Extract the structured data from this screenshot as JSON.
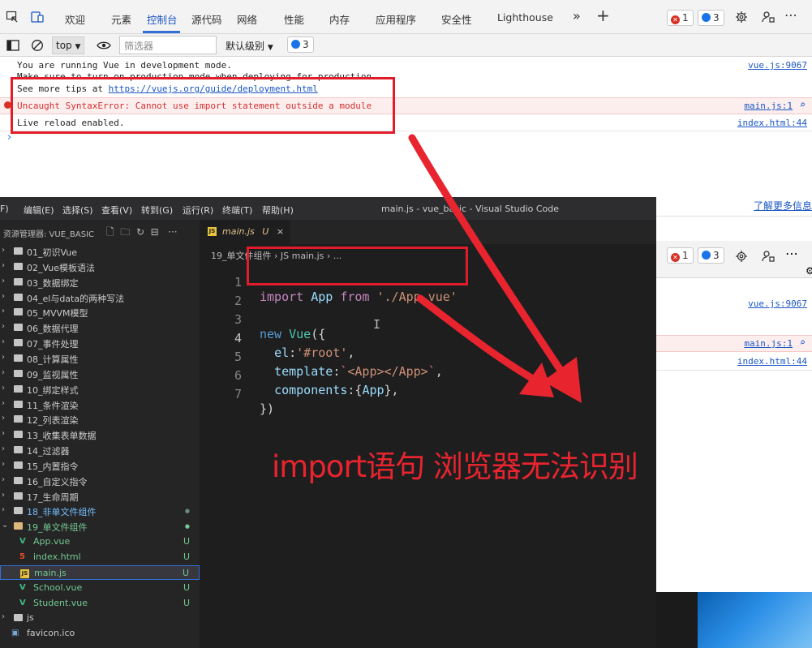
{
  "devtools": {
    "tabs": [
      "欢迎",
      "元素",
      "控制台",
      "源代码",
      "网络",
      "性能",
      "内存",
      "应用程序",
      "安全性",
      "Lighthouse"
    ],
    "active_tab": "控制台",
    "more_tabs": "»",
    "add_tab": "+",
    "error_count": "1",
    "message_count": "3",
    "toolbar": {
      "context": "top",
      "filter_placeholder": "筛选器",
      "level": "默认级别",
      "message_count": "3"
    },
    "console": [
      {
        "text": "You are running Vue in development mode.",
        "source": "vue.js:9067",
        "type": "log"
      },
      {
        "text": "Make sure to turn on production mode when deploying for production.",
        "source": "",
        "type": "log"
      },
      {
        "text": "See more tips at https://vuejs.org/guide/deployment.html",
        "source": "",
        "type": "log"
      },
      {
        "text": "Uncaught SyntaxError: Cannot use import statement outside a module",
        "source": "main.js:1",
        "type": "error"
      },
      {
        "text": "Live reload enabled.",
        "source": "index.html:44",
        "type": "log"
      }
    ],
    "prompt": "›",
    "learn_more": "了解更多信息",
    "second_view": {
      "error_count": "1",
      "message_count": "3",
      "sources": [
        "vue.js:9067",
        "main.js:1",
        "index.html:44"
      ]
    }
  },
  "vscode": {
    "menu": [
      "F)",
      "编辑(E)",
      "选择(S)",
      "查看(V)",
      "转到(G)",
      "运行(R)",
      "终端(T)",
      "帮助(H)"
    ],
    "window_title": "main.js - vue_basic - Visual Studio Code",
    "explorer_title": "资源管理器: VUE_BASIC",
    "tree": [
      {
        "name": "01_初识Vue",
        "kind": "folder"
      },
      {
        "name": "02_Vue模板语法",
        "kind": "folder"
      },
      {
        "name": "03_数据绑定",
        "kind": "folder"
      },
      {
        "name": "04_el与data的两种写法",
        "kind": "folder"
      },
      {
        "name": "05_MVVM模型",
        "kind": "folder"
      },
      {
        "name": "06_数据代理",
        "kind": "folder"
      },
      {
        "name": "07_事件处理",
        "kind": "folder"
      },
      {
        "name": "08_计算属性",
        "kind": "folder"
      },
      {
        "name": "09_监视属性",
        "kind": "folder"
      },
      {
        "name": "10_绑定样式",
        "kind": "folder"
      },
      {
        "name": "11_条件渲染",
        "kind": "folder"
      },
      {
        "name": "12_列表渲染",
        "kind": "folder"
      },
      {
        "name": "13_收集表单数据",
        "kind": "folder"
      },
      {
        "name": "14_过滤器",
        "kind": "folder"
      },
      {
        "name": "15_内置指令",
        "kind": "folder"
      },
      {
        "name": "16_自定义指令",
        "kind": "folder"
      },
      {
        "name": "17_生命周期",
        "kind": "folder"
      },
      {
        "name": "18_非单文件组件",
        "kind": "folder-modified"
      },
      {
        "name": "19_单文件组件",
        "kind": "folder-open"
      },
      {
        "name": "App.vue",
        "kind": "vue",
        "status": "U"
      },
      {
        "name": "index.html",
        "kind": "html",
        "status": "U"
      },
      {
        "name": "main.js",
        "kind": "js",
        "status": "U"
      },
      {
        "name": "School.vue",
        "kind": "vue",
        "status": "U"
      },
      {
        "name": "Student.vue",
        "kind": "vue",
        "status": "U"
      },
      {
        "name": "js",
        "kind": "folder"
      },
      {
        "name": "favicon.ico",
        "kind": "ico"
      }
    ],
    "tab": {
      "name": "main.js",
      "status": "U",
      "close": "×"
    },
    "breadcrumb": "19_单文件组件 › JS main.js › ...",
    "code_lines": [
      "1",
      "2",
      "3",
      "4",
      "5",
      "6",
      "7"
    ]
  },
  "annotation_text": "import语句 浏览器无法识别",
  "colors": {
    "annotation": "#e8242f",
    "highlight_box": "#e21d2b"
  }
}
